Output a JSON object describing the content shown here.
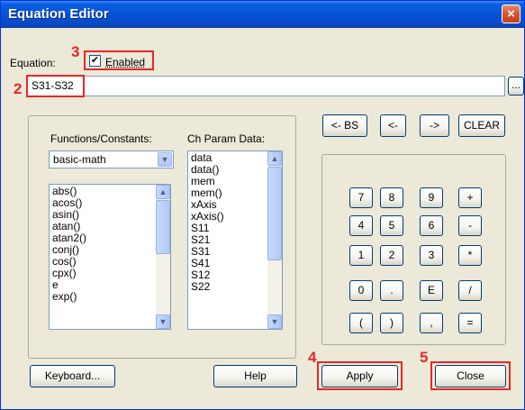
{
  "window": {
    "title": "Equation Editor",
    "close_glyph": "×"
  },
  "equation": {
    "label": "Equation:",
    "enabled_label": "Enabled",
    "enabled_checked": true,
    "check_glyph": "✔",
    "value": "S31-S32",
    "browse_label": "..."
  },
  "functions": {
    "label": "Functions/Constants:",
    "selected": "basic-math",
    "items": [
      "abs()",
      "acos()",
      "asin()",
      "atan()",
      "atan2()",
      "conj()",
      "cos()",
      "cpx()",
      "e",
      "exp()"
    ]
  },
  "params": {
    "label": "Ch Param Data:",
    "items": [
      "data",
      "data()",
      "mem",
      "mem()",
      "xAxis",
      "xAxis()",
      "S11",
      "S21",
      "S31",
      "S41",
      "S12",
      "S22"
    ]
  },
  "edit_buttons": [
    "<- BS",
    "<-",
    "->",
    "CLEAR"
  ],
  "keypad": [
    [
      "7",
      "8",
      "9",
      "+"
    ],
    [
      "4",
      "5",
      "6",
      "-"
    ],
    [
      "1",
      "2",
      "3",
      "*"
    ],
    [
      "0",
      ".",
      "E",
      "/"
    ],
    [
      "(",
      ")",
      ",",
      "="
    ]
  ],
  "footer": {
    "keyboard_label": "Keyboard...",
    "help_label": "Help",
    "apply_label": "Apply",
    "close_label": "Close"
  },
  "annotations": {
    "enabled": "3",
    "equation": "2",
    "apply": "4",
    "close": "5"
  },
  "colors": {
    "annotation": "#e8262a",
    "titlebar": "#0553d6",
    "dialog": "#ece9d8"
  }
}
